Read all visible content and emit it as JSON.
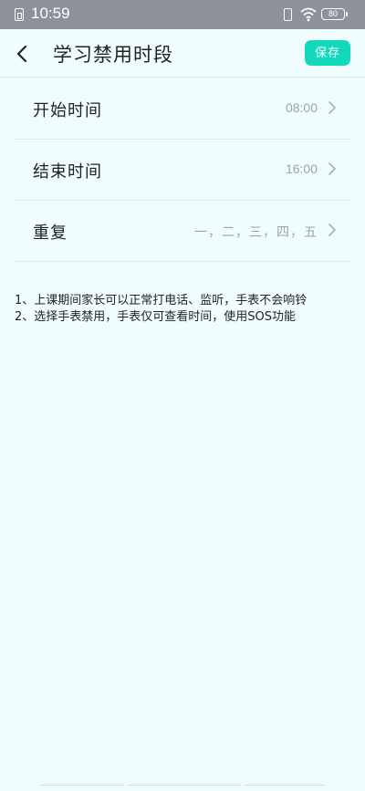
{
  "status_bar": {
    "time": "10:59",
    "battery": "80"
  },
  "header": {
    "title": "学习禁用时段",
    "save_label": "保存"
  },
  "settings": [
    {
      "label": "开始时间",
      "value": "08:00"
    },
    {
      "label": "结束时间",
      "value": "16:00"
    },
    {
      "label": "重复",
      "value": "一，二，三，四，五"
    }
  ],
  "notes": [
    "1、上课期间家长可以正常打电话、监听，手表不会响铃",
    "2、选择手表禁用，手表仅可查看时间，使用SOS功能"
  ],
  "colors": {
    "accent": "#12d8bc",
    "background": "#effefc",
    "status_bar": "#8d919a"
  }
}
